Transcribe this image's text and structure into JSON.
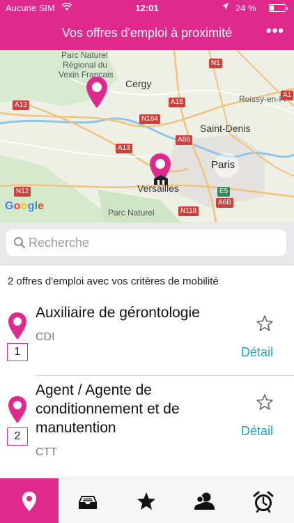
{
  "status_bar": {
    "carrier": "Aucune SIM",
    "time": "12:01",
    "battery": "24 %",
    "battery_level": 0.24
  },
  "header": {
    "title": "Vos offres d'emploi à proximité",
    "more": "•••"
  },
  "map": {
    "labels": {
      "vexin_1": "Parc Naturel",
      "vexin_2": "Régional du",
      "vexin_3": "Vexin Français",
      "cergy": "Cergy",
      "roissy": "Roissy-en-Fr",
      "saint_denis": "Saint-Denis",
      "paris": "Paris",
      "versailles": "Versailles",
      "parc_naturel": "Parc Naturel"
    },
    "roads": {
      "a13_left": "A13",
      "a15": "A15",
      "n184": "N184",
      "a86": "A86",
      "a13_mid": "A13",
      "n1": "N1",
      "n12": "N12",
      "n118": "N118",
      "e5": "E5",
      "a6b": "A6B",
      "a1": "A1"
    },
    "google": [
      "G",
      "o",
      "o",
      "g",
      "l",
      "e"
    ],
    "marker_color": "#e0298c"
  },
  "search": {
    "placeholder": "Recherche"
  },
  "results": {
    "count_text": "2 offres d'emploi avec vos critères de mobilité"
  },
  "jobs": [
    {
      "rank": "1",
      "title": "Auxiliaire de gérontologie",
      "contract": "CDI",
      "detail": "Détail"
    },
    {
      "rank": "2",
      "title": "Agent / Agente de conditionnement et de manutention",
      "contract": "CTT",
      "detail": "Détail"
    }
  ],
  "tabbar": {
    "items": [
      {
        "icon": "map-pin-icon",
        "active": true
      },
      {
        "icon": "inbox-tray-icon",
        "active": false
      },
      {
        "icon": "star-icon",
        "active": false
      },
      {
        "icon": "user-profile-icon",
        "active": false
      },
      {
        "icon": "alarm-clock-icon",
        "active": false
      }
    ]
  },
  "colors": {
    "brand": "#e0298c",
    "link": "#1aa6c9"
  }
}
